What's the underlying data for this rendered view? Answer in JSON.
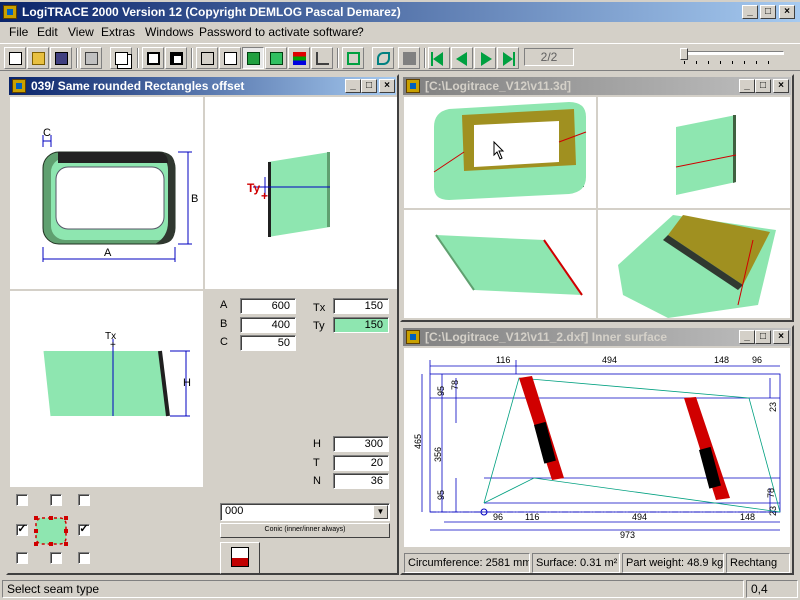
{
  "app": {
    "title": "LogiTRACE 2000  Version 12  (Copyright DEMLOG Pascal Demarez)"
  },
  "menu": [
    "File",
    "Edit",
    "View",
    "Extras",
    "Windows",
    "Password to activate software",
    "?"
  ],
  "toolbar": {
    "page_indicator": "2/2"
  },
  "win_main": {
    "title": "039/ Same rounded Rectangles offset",
    "labels": {
      "c": "C",
      "b": "B",
      "a": "A",
      "ty": "Ty",
      "tx": "Tx",
      "h": "H",
      "plus": "+"
    },
    "params_left": [
      {
        "label": "A",
        "value": "600"
      },
      {
        "label": "B",
        "value": "400"
      },
      {
        "label": "C",
        "value": "50"
      }
    ],
    "params_right": [
      {
        "label": "Tx",
        "value": "150"
      },
      {
        "label": "Ty",
        "value": "150"
      }
    ],
    "params_bottom": [
      {
        "label": "H",
        "value": "300"
      },
      {
        "label": "T",
        "value": "20"
      },
      {
        "label": "N",
        "value": "36"
      }
    ],
    "seam_select": "000",
    "conic_button": "Conic (inner/inner always)",
    "checkboxes": [
      "",
      "",
      "",
      "✓",
      "✓",
      "",
      "",
      ""
    ]
  },
  "win_3d": {
    "title": "[C:\\Logitrace_V12\\v11.3d]"
  },
  "win_dxf": {
    "title": "[C:\\Logitrace_V12\\v11_2.dxf]  Inner surface",
    "dims_top": [
      "116",
      "494",
      "148",
      "96"
    ],
    "dims_bottom": [
      "96",
      "116",
      "494",
      "148"
    ],
    "dim_total": "973",
    "dims_left": [
      "465",
      "356",
      "95",
      "95",
      "78",
      "78"
    ],
    "dims_right": [
      "23",
      "23"
    ],
    "info": {
      "circumference": "Circumference: 2581 mm",
      "surface": "Surface: 0.31 m²",
      "weight": "Part weight: 48.9 kg",
      "shape": "Rechtang"
    }
  },
  "status": {
    "message": "Select seam type",
    "value": "0,4"
  },
  "colors": {
    "accent": "#0a246a",
    "shape_green": "#8ee6b0",
    "dim_blue": "#0000c0",
    "seam_red": "#d00000",
    "inner_olive": "#a09020"
  }
}
